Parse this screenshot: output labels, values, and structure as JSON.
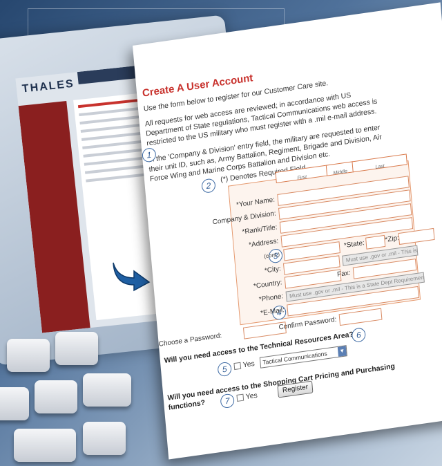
{
  "monitor": {
    "logo": "THALES"
  },
  "form": {
    "title": "Create A User Account",
    "intro": "Use the form below to register for our Customer Care site.",
    "para1_line1": "All requests for web access are reviewed; in accordance with US",
    "para1_line2": "Department of State regulations, Tactical Communications web access is",
    "para1_line3": "restricted to the US military who must register with a .mil e-mail address.",
    "para2_line1": "In the 'Company & Division' entry field, the military are requested to enter",
    "para2_line2": "their unit ID, such as, Army Battalion, Regiment, Brigade and Division, Air",
    "para2_line3": "Force Wing and Marine Corps Battalion and Division etc.",
    "required_note": "(*) Denotes Required Field",
    "name_headers": {
      "first": "First",
      "middle": "Middle",
      "last": "Last"
    },
    "labels": {
      "your_name": "*Your Name:",
      "company": "Company & Division:",
      "rank": "*Rank/Title:",
      "address": "*Address:",
      "cont": "(cont.)",
      "state": "*State:",
      "zip": "*Zip:",
      "city": "*City:",
      "country": "*Country:",
      "fax": "Fax:",
      "phone": "*Phone:",
      "email": "*E-Mail:",
      "password": "Choose a Password:",
      "confirm": "Confirm Password:"
    },
    "phone_note": "Must use .gov or .mil - This is a State Dept Requirement",
    "email_note": "Must use .gov or .mil - This is a State Dept Requirement",
    "q_tech": "Will you need access to the Technical Resources Area?",
    "q_shop_line1": "Will you need access to the Shopping Cart Pricing and Purchasing",
    "q_shop_line2": "functions?",
    "yes_label": "Yes",
    "dropdown_value": "Tactical Communications",
    "register_button": "Register"
  },
  "callouts": [
    "1",
    "2",
    "3",
    "4",
    "5",
    "6",
    "7"
  ],
  "icons": {
    "arrow": "curved-arrow-icon",
    "dropdown": "chevron-down-icon"
  }
}
